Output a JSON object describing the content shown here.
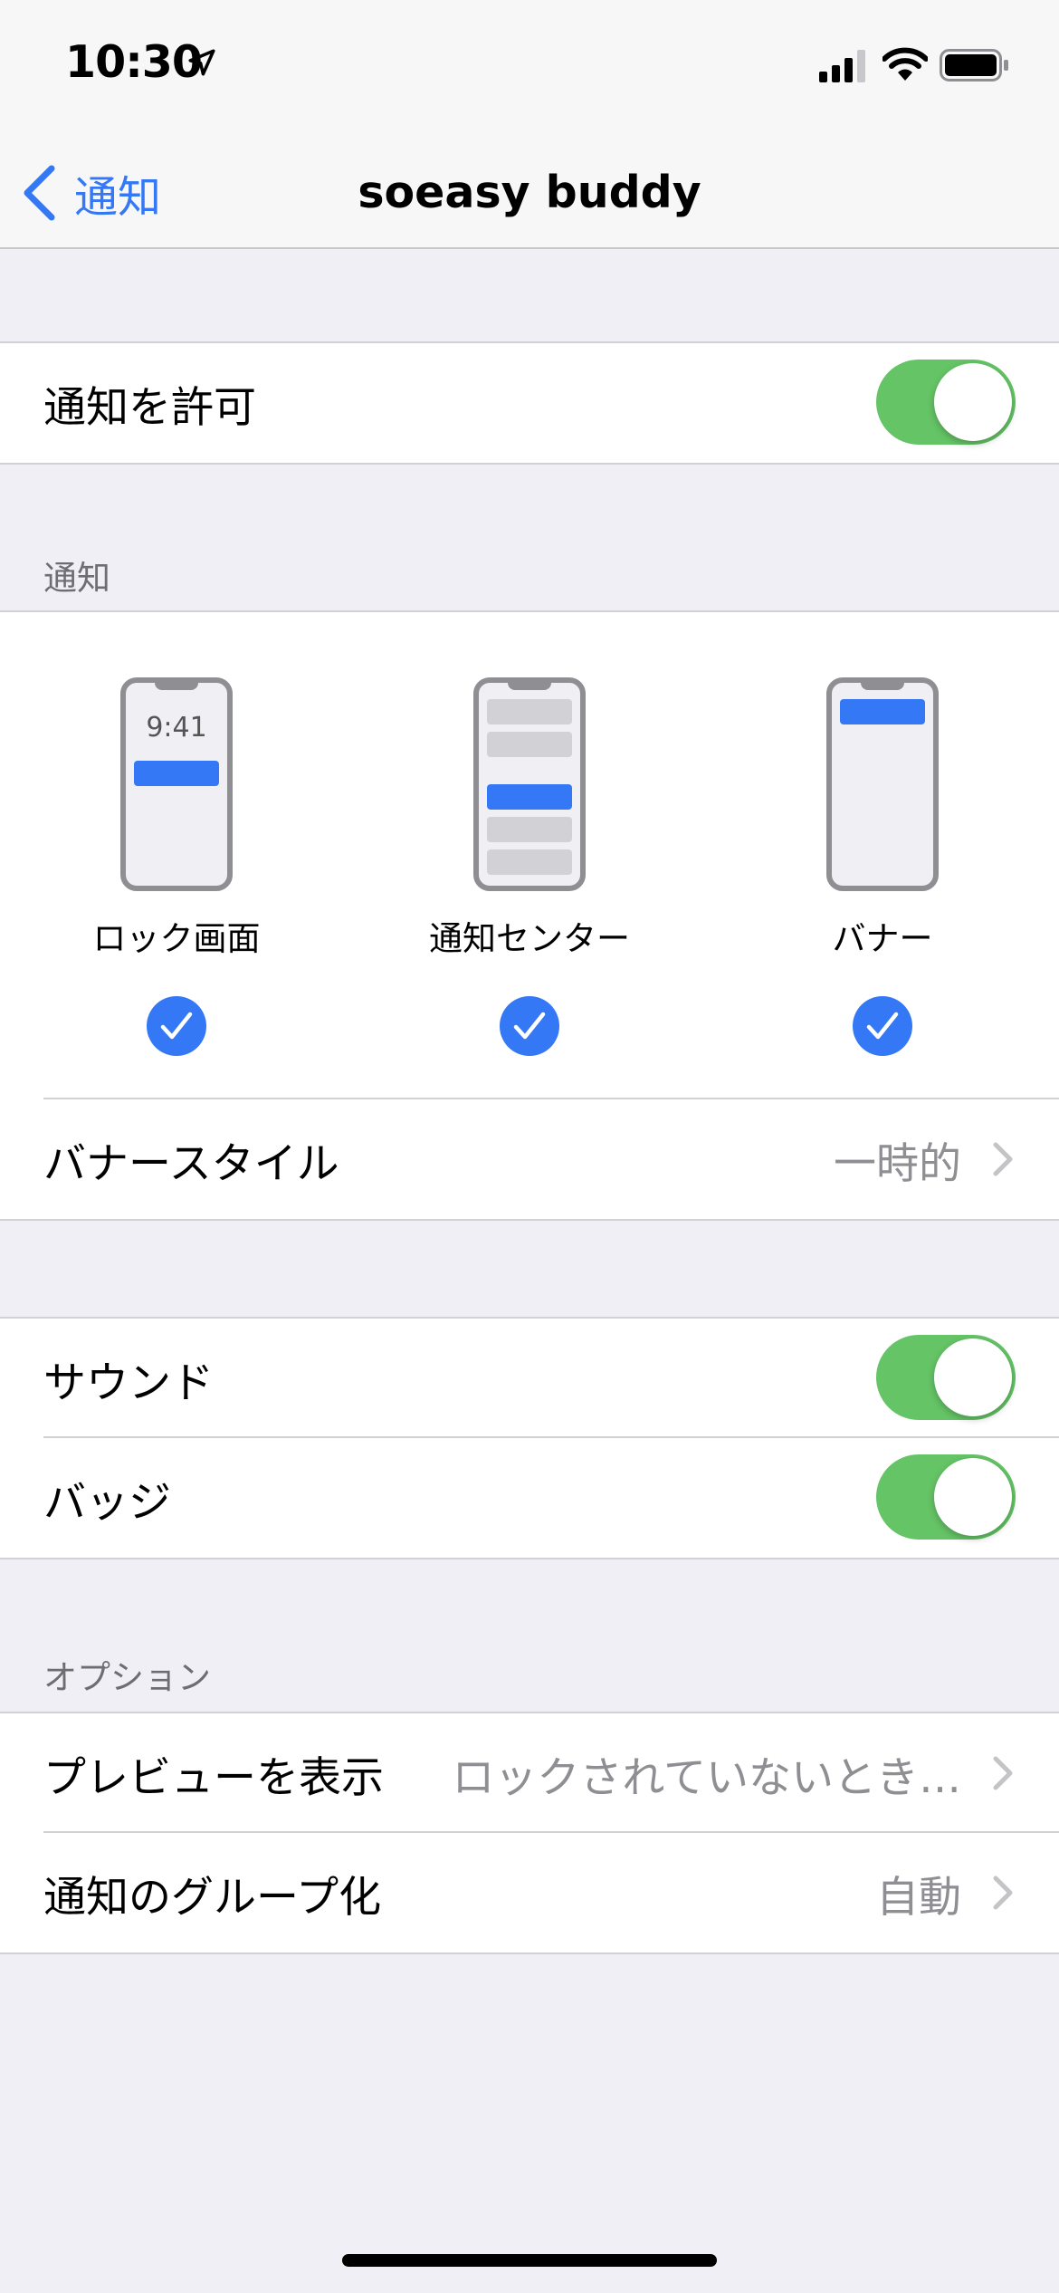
{
  "status_bar": {
    "time": "10:30"
  },
  "nav": {
    "back_label": "通知",
    "title": "soeasy buddy"
  },
  "allow_group": {
    "label": "通知を許可",
    "enabled": true
  },
  "alerts_section": {
    "header": "通知",
    "styles": [
      {
        "label": "ロック画面",
        "clock": "9:41",
        "checked": true
      },
      {
        "label": "通知センター",
        "checked": true
      },
      {
        "label": "バナー",
        "checked": true
      }
    ],
    "banner_style": {
      "label": "バナースタイル",
      "value": "一時的"
    }
  },
  "sound_group": {
    "sound_label": "サウンド",
    "sound_enabled": true,
    "badge_label": "バッジ",
    "badge_enabled": true
  },
  "options_section": {
    "header": "オプション",
    "preview": {
      "label": "プレビューを表示",
      "value": "ロックされていないとき…"
    },
    "grouping": {
      "label": "通知のグループ化",
      "value": "自動"
    }
  },
  "colors": {
    "accent": "#3478f6",
    "toggle_on": "#65c466",
    "background": "#f0eff5"
  }
}
